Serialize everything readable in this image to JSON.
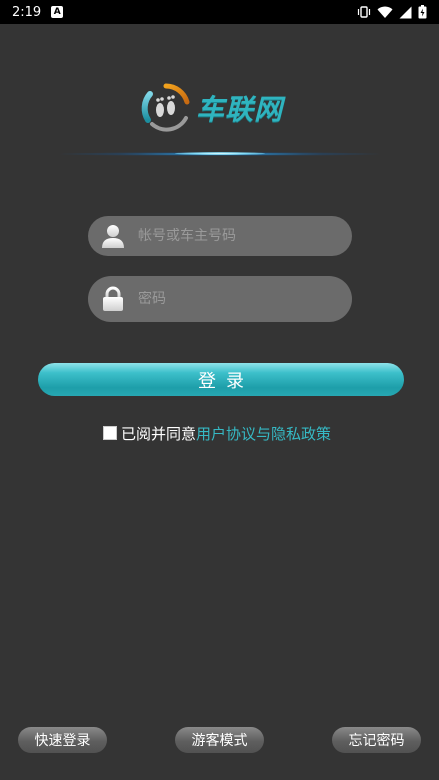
{
  "status_bar": {
    "time": "2:19",
    "notification_icon": "A"
  },
  "logo": {
    "text": "车联网",
    "icon": "footprint-logo-icon"
  },
  "login_form": {
    "account_placeholder": "帐号或车主号码",
    "account_value": "",
    "password_placeholder": "密码",
    "password_value": "",
    "login_label": "登录"
  },
  "agreement": {
    "prefix": "已阅并同意",
    "link": "用户协议与隐私政策",
    "checked": false
  },
  "bottom_actions": {
    "quick_login": "快速登录",
    "guest_mode": "游客模式",
    "forgot_password": "忘记密码"
  },
  "colors": {
    "background": "#343434",
    "accent": "#2fb4bf",
    "field_bg": "#6b6b6b"
  }
}
